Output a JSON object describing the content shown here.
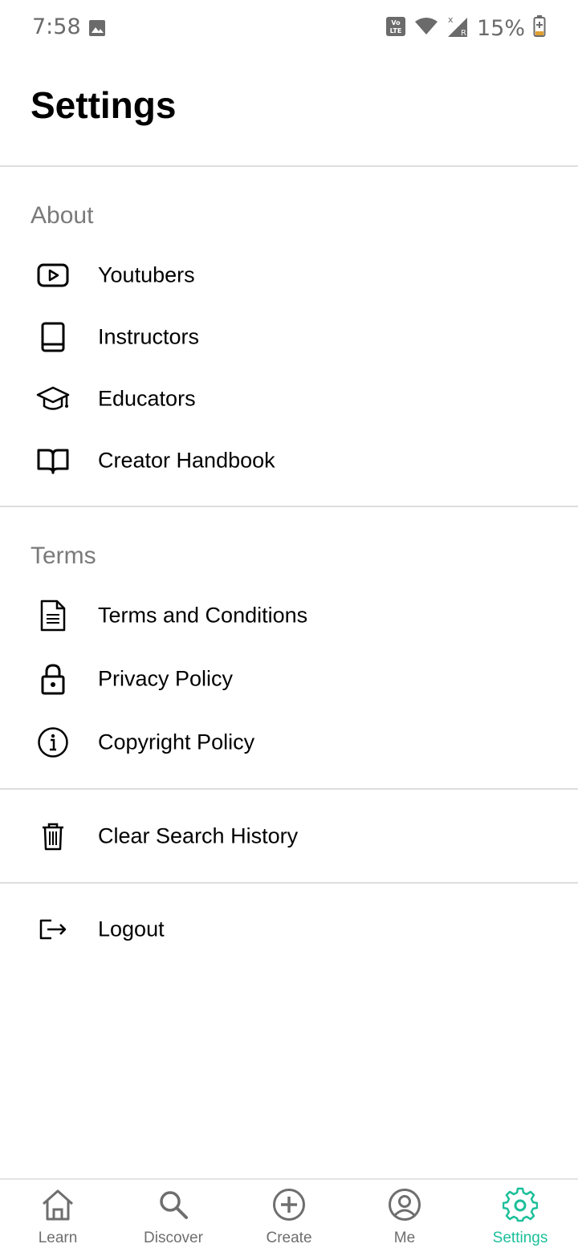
{
  "status_bar": {
    "time": "7:58",
    "battery": "15%",
    "icons": [
      "gallery-icon",
      "volte-icon",
      "wifi-icon",
      "signal-icon",
      "battery-icon"
    ]
  },
  "header": {
    "title": "Settings"
  },
  "sections": {
    "about": {
      "title": "About",
      "items": [
        {
          "label": "Youtubers",
          "icon": "youtube-icon"
        },
        {
          "label": "Instructors",
          "icon": "book-icon"
        },
        {
          "label": "Educators",
          "icon": "graduation-cap-icon"
        },
        {
          "label": "Creator Handbook",
          "icon": "open-book-icon"
        }
      ]
    },
    "terms": {
      "title": "Terms",
      "items": [
        {
          "label": "Terms and Conditions",
          "icon": "document-icon"
        },
        {
          "label": "Privacy Policy",
          "icon": "lock-icon"
        },
        {
          "label": "Copyright Policy",
          "icon": "info-icon"
        }
      ]
    },
    "actions": {
      "clear_search": {
        "label": "Clear Search History",
        "icon": "trash-icon"
      },
      "logout": {
        "label": "Logout",
        "icon": "logout-icon"
      }
    }
  },
  "bottom_nav": {
    "active_color": "#1cbf9a",
    "items": [
      {
        "label": "Learn",
        "icon": "home-icon"
      },
      {
        "label": "Discover",
        "icon": "search-icon"
      },
      {
        "label": "Create",
        "icon": "plus-circle-icon"
      },
      {
        "label": "Me",
        "icon": "user-icon"
      },
      {
        "label": "Settings",
        "icon": "gear-icon",
        "active": true
      }
    ]
  }
}
